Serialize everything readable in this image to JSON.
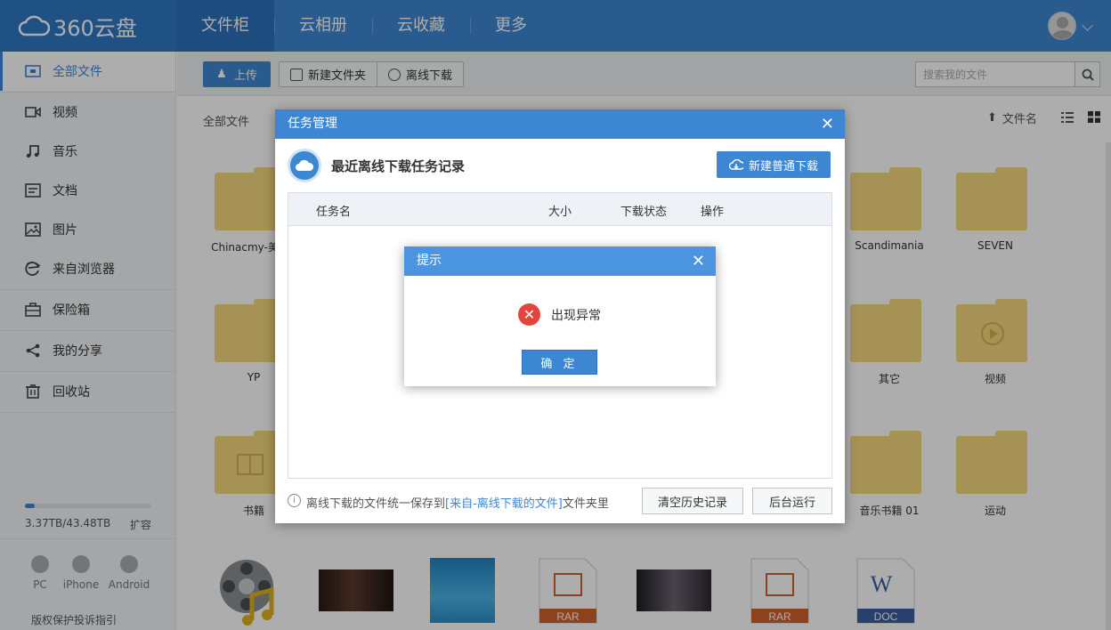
{
  "app": {
    "logo_text": "360云盘"
  },
  "nav": {
    "items": [
      "文件柜",
      "云相册",
      "云收藏",
      "更多"
    ]
  },
  "sidebar": {
    "items": [
      {
        "label": "全部文件",
        "icon": "all-files-icon"
      },
      {
        "label": "视频",
        "icon": "video-icon"
      },
      {
        "label": "音乐",
        "icon": "music-icon"
      },
      {
        "label": "文档",
        "icon": "document-icon"
      },
      {
        "label": "图片",
        "icon": "image-icon"
      },
      {
        "label": "来自浏览器",
        "icon": "browser-icon"
      },
      {
        "label": "保险箱",
        "icon": "safe-icon"
      },
      {
        "label": "我的分享",
        "icon": "share-icon"
      },
      {
        "label": "回收站",
        "icon": "trash-icon"
      }
    ],
    "storage": {
      "text": "3.37TB/43.48TB",
      "used_fraction": 0.077,
      "expand": "扩容"
    },
    "clients": [
      "PC",
      "iPhone",
      "Android"
    ],
    "copyright": "版权保护投诉指引"
  },
  "toolbar": {
    "upload": "上传",
    "new_folder": "新建文件夹",
    "offline_download": "离线下载",
    "search_placeholder": "搜索我的文件"
  },
  "content": {
    "breadcrumb": "全部文件",
    "sort_label": "文件名",
    "folders": [
      "Chinacmy-美利",
      "Scandimania",
      "SEVEN",
      "YP",
      "其它",
      "视频",
      "书籍",
      "音乐书籍 01",
      "运动"
    ],
    "file_types": [
      "RAR",
      "RAR",
      "DOC"
    ]
  },
  "task_dialog": {
    "title": "任务管理",
    "heading": "最近离线下载任务记录",
    "new_download": "新建普通下载",
    "columns": [
      "任务名",
      "大小",
      "下载状态",
      "操作"
    ],
    "footer_prefix": "离线下载的文件统一保存到",
    "footer_link": "[来自-离线下载的文件]",
    "footer_suffix": "文件夹里",
    "clear_history": "清空历史记录",
    "background_run": "后台运行"
  },
  "alert": {
    "title": "提示",
    "message": "出现异常",
    "ok": "确 定"
  },
  "colors": {
    "brand": "#3d86d2",
    "error": "#e2453c",
    "folder": "#f5d87c"
  }
}
